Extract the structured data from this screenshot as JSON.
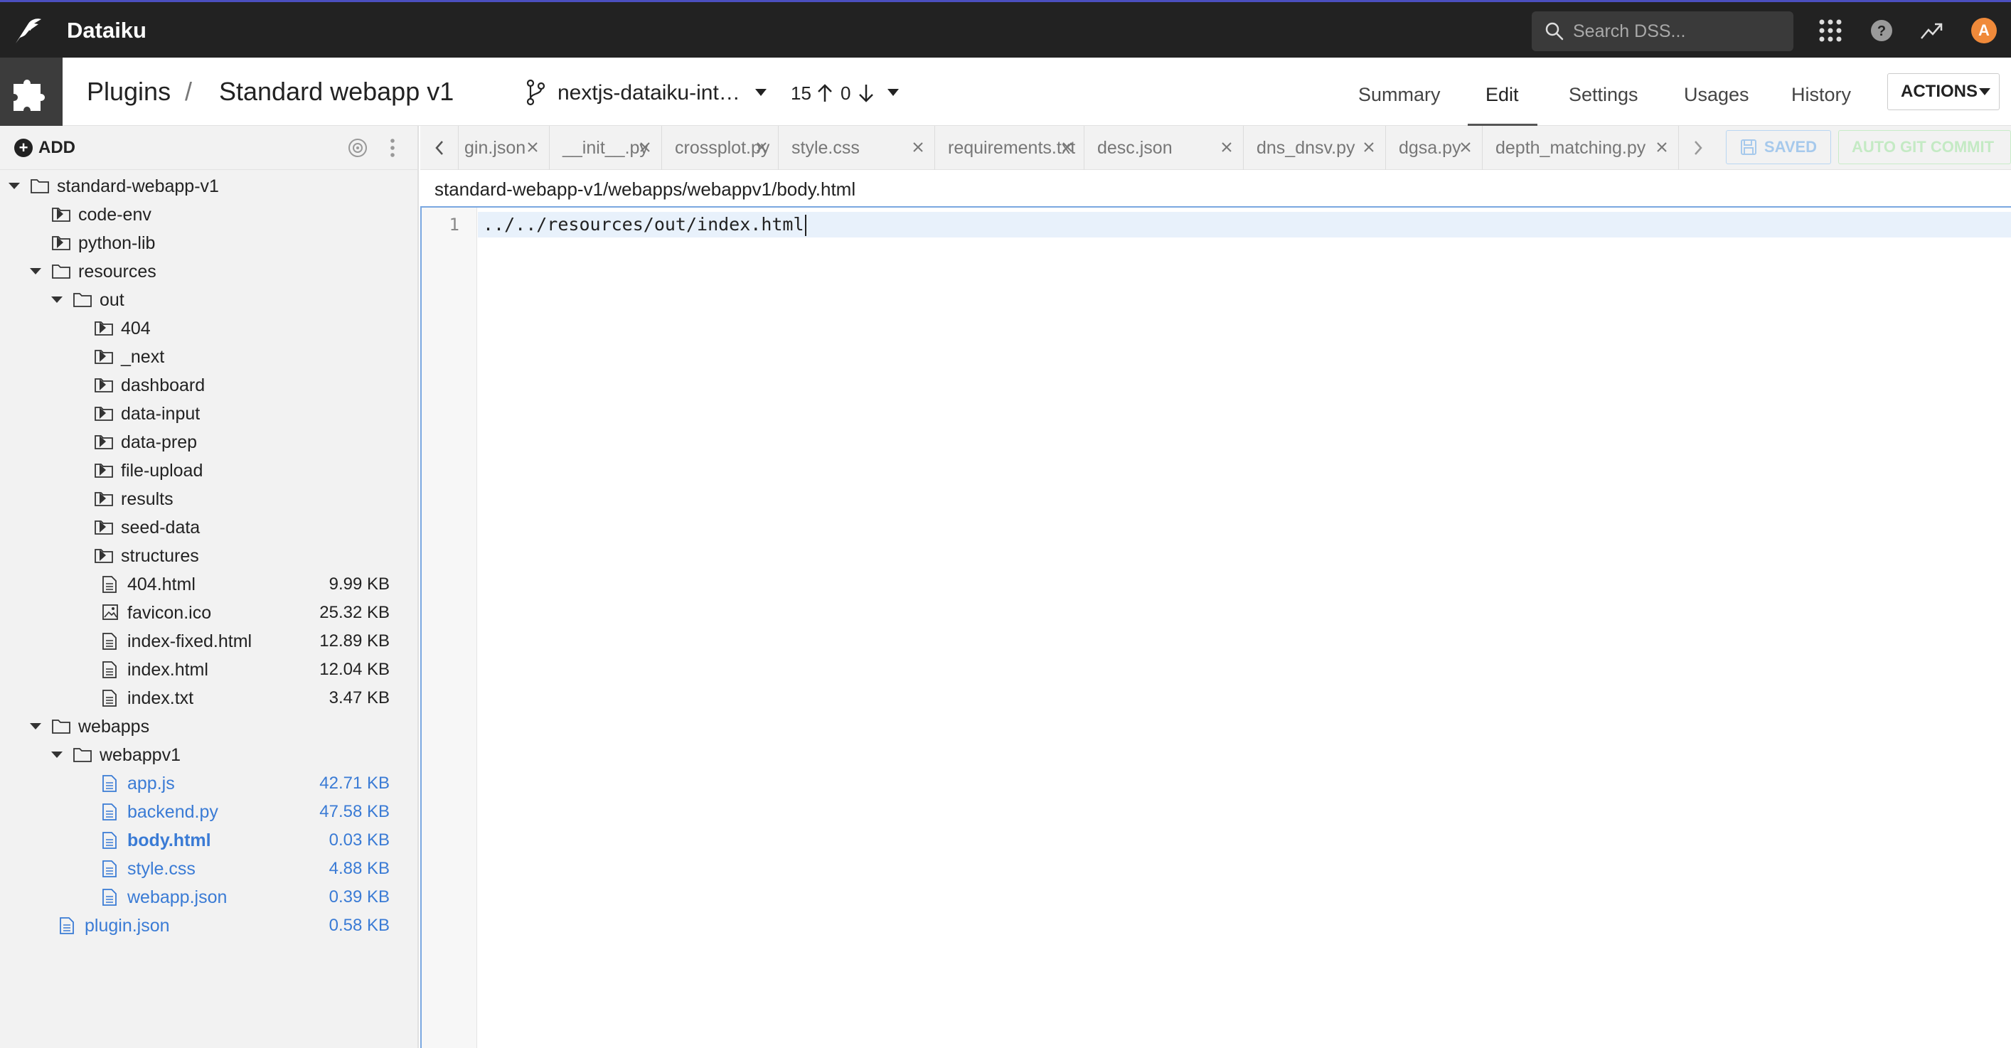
{
  "app": {
    "name": "Dataiku"
  },
  "search": {
    "placeholder": "Search DSS..."
  },
  "user": {
    "avatar_letter": "A"
  },
  "breadcrumb": {
    "root": "Plugins",
    "current": "Standard webapp v1"
  },
  "git": {
    "branch": "nextjs-dataiku-int…",
    "ahead": "15",
    "behind": "0"
  },
  "nav": {
    "summary": "Summary",
    "edit": "Edit",
    "settings": "Settings",
    "usages": "Usages",
    "history": "History",
    "actions": "ACTIONS",
    "active": "Edit"
  },
  "sidebar": {
    "add_label": "ADD",
    "tree": [
      {
        "label": "standard-webapp-v1",
        "type": "folder",
        "state": "open",
        "depth": 0
      },
      {
        "label": "code-env",
        "type": "folder",
        "state": "closed",
        "depth": 1
      },
      {
        "label": "python-lib",
        "type": "folder",
        "state": "closed",
        "depth": 1
      },
      {
        "label": "resources",
        "type": "folder",
        "state": "open",
        "depth": 1
      },
      {
        "label": "out",
        "type": "folder",
        "state": "open",
        "depth": 2
      },
      {
        "label": "404",
        "type": "folder",
        "state": "closed",
        "depth": 3
      },
      {
        "label": "_next",
        "type": "folder",
        "state": "closed",
        "depth": 3
      },
      {
        "label": "dashboard",
        "type": "folder",
        "state": "closed",
        "depth": 3
      },
      {
        "label": "data-input",
        "type": "folder",
        "state": "closed",
        "depth": 3
      },
      {
        "label": "data-prep",
        "type": "folder",
        "state": "closed",
        "depth": 3
      },
      {
        "label": "file-upload",
        "type": "folder",
        "state": "closed",
        "depth": 3
      },
      {
        "label": "results",
        "type": "folder",
        "state": "closed",
        "depth": 3
      },
      {
        "label": "seed-data",
        "type": "folder",
        "state": "closed",
        "depth": 3
      },
      {
        "label": "structures",
        "type": "folder",
        "state": "closed",
        "depth": 3
      },
      {
        "label": "404.html",
        "type": "file",
        "size": "9.99 KB",
        "depth": 3
      },
      {
        "label": "favicon.ico",
        "type": "image",
        "size": "25.32 KB",
        "depth": 3
      },
      {
        "label": "index-fixed.html",
        "type": "file",
        "size": "12.89 KB",
        "depth": 3
      },
      {
        "label": "index.html",
        "type": "file",
        "size": "12.04 KB",
        "depth": 3
      },
      {
        "label": "index.txt",
        "type": "file",
        "size": "3.47 KB",
        "depth": 3
      },
      {
        "label": "webapps",
        "type": "folder",
        "state": "open",
        "depth": 1
      },
      {
        "label": "webappv1",
        "type": "folder",
        "state": "open",
        "depth": 2
      },
      {
        "label": "app.js",
        "type": "file",
        "size": "42.71 KB",
        "depth": 3,
        "highlight": true
      },
      {
        "label": "backend.py",
        "type": "file",
        "size": "47.58 KB",
        "depth": 3,
        "highlight": true
      },
      {
        "label": "body.html",
        "type": "file",
        "size": "0.03 KB",
        "depth": 3,
        "highlight": true,
        "selected": true
      },
      {
        "label": "style.css",
        "type": "file",
        "size": "4.88 KB",
        "depth": 3,
        "highlight": true
      },
      {
        "label": "webapp.json",
        "type": "file",
        "size": "0.39 KB",
        "depth": 3,
        "highlight": true
      },
      {
        "label": "plugin.json",
        "type": "file",
        "size": "0.58 KB",
        "depth": 1,
        "highlight": true
      }
    ]
  },
  "tabs": [
    {
      "label": "gin.json"
    },
    {
      "label": "__init__.py"
    },
    {
      "label": "crossplot.py"
    },
    {
      "label": "style.css"
    },
    {
      "label": "requirements.txt"
    },
    {
      "label": "desc.json"
    },
    {
      "label": "dns_dnsv.py"
    },
    {
      "label": "dgsa.py"
    },
    {
      "label": "depth_matching.py"
    }
  ],
  "editor": {
    "saved_label": "SAVED",
    "autogit_label": "AUTO GIT COMMIT",
    "path": "standard-webapp-v1/webapps/webappv1/body.html",
    "lines": [
      {
        "number": "1",
        "text": "../../resources/out/index.html"
      }
    ]
  },
  "colors": {
    "topbar": "#222222",
    "accent_top": "#4b4fbf",
    "link_blue": "#3a7bd5",
    "avatar": "#f08a3a",
    "saved": "#a6c9ec",
    "autogit": "#c4eac4"
  }
}
